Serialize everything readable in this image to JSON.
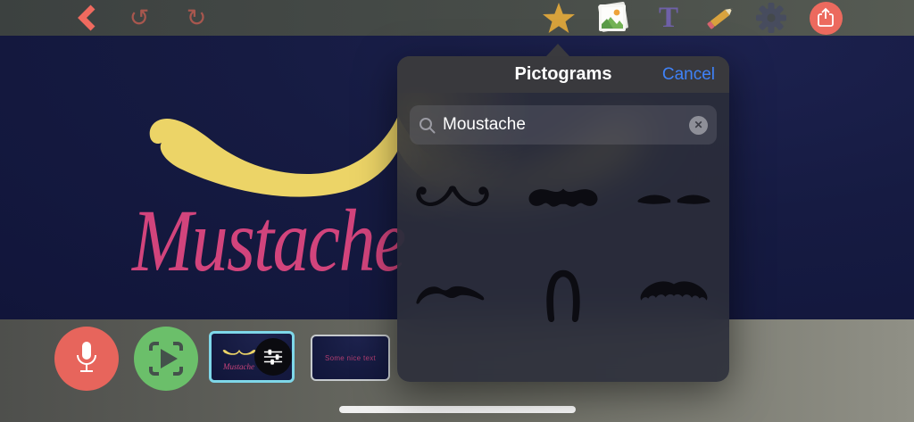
{
  "toolbar": {
    "icons": [
      "back",
      "undo",
      "redo",
      "pictograms-star",
      "photos",
      "text",
      "pencil",
      "settings-gear",
      "share"
    ],
    "undo_glyph": "↺",
    "redo_glyph": "↻",
    "text_tool_glyph": "T"
  },
  "popover": {
    "title": "Pictograms",
    "cancel_label": "Cancel",
    "search": {
      "value": "Moustache",
      "clear_glyph": "✕",
      "icon": "magnifier"
    },
    "pictograms": [
      "handlebar-mustache",
      "full-wavy-mustache",
      "pencil-thin-mustache",
      "natural-mustache",
      "horseshoe-mustache",
      "walrus-mustache"
    ]
  },
  "canvas": {
    "slide_text": "Mustache",
    "background": "#161b42",
    "mustache_color": "#ecd467",
    "text_color": "#d2447c"
  },
  "timeline": {
    "record_button": "microphone",
    "play_button": "play-preview",
    "slides": [
      {
        "label": "Mustache",
        "selected": true,
        "badge": "adjustment-sliders"
      },
      {
        "label": "Some nice text",
        "selected": false
      }
    ]
  },
  "colors": {
    "accent_blue": "#3f82f8",
    "selection_cyan": "#7ed7e9",
    "record_red": "#e7655c",
    "play_green": "#6bbf6a",
    "star_gold": "#d7a23c",
    "share_red": "#ec6a5e",
    "back_coral": "#ef6a5f"
  }
}
